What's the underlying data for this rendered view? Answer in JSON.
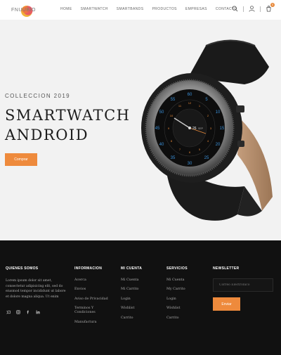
{
  "header": {
    "logo_text": "FNUUBIO",
    "nav": [
      "HOME",
      "SMARTWATCH",
      "SMARTBANDS",
      "PRODUCTOS",
      "EMPRESAS",
      "CONTACTO"
    ],
    "cart_count": "0",
    "icons": [
      "search-icon",
      "user-icon",
      "cart-icon"
    ]
  },
  "hero": {
    "collection": "COLLECCION 2019",
    "title_line1": "SMARTWATCH",
    "title_line2": "ANDROID",
    "cta": "Comprar",
    "watch_face": {
      "date_day": "26",
      "date_month": "SEP",
      "numbers": [
        "5",
        "10",
        "15",
        "20",
        "25",
        "30",
        "35",
        "40",
        "45",
        "50",
        "55",
        "60"
      ]
    }
  },
  "footer": {
    "about": {
      "heading": "QUIENES SOMOS",
      "text": "Lorem ipsum dolor sit amet, consectetur adipisicing elit, sed do eiusmod tempor incididunt ut labore et dolore magna aliqua. Ut enim"
    },
    "info": {
      "heading": "INFORMACION",
      "items": [
        "Acerca",
        "Envios",
        "Aviso de Privacidad",
        "Terminos Y Condiciones",
        "Manufactura"
      ]
    },
    "account": {
      "heading": "MI CUENTA",
      "items": [
        "Mi Cuenta",
        "Mi Carrito",
        "Login",
        "Wishlist",
        "Carrito"
      ]
    },
    "services": {
      "heading": "SERVICIOS",
      "items": [
        "Mi Cuenta",
        "My Carrito",
        "Login",
        "Wishlist",
        "Carrito"
      ]
    },
    "newsletter": {
      "heading": "NEWSLETTER",
      "placeholder": "Correo Electronico",
      "button": "Enviar"
    },
    "socials": [
      "twitter-icon",
      "instagram-icon",
      "facebook-icon",
      "linkedin-icon"
    ]
  },
  "colors": {
    "accent": "#ee8a3c",
    "footer_bg": "#111111",
    "hero_bg": "#f2f2f2"
  }
}
